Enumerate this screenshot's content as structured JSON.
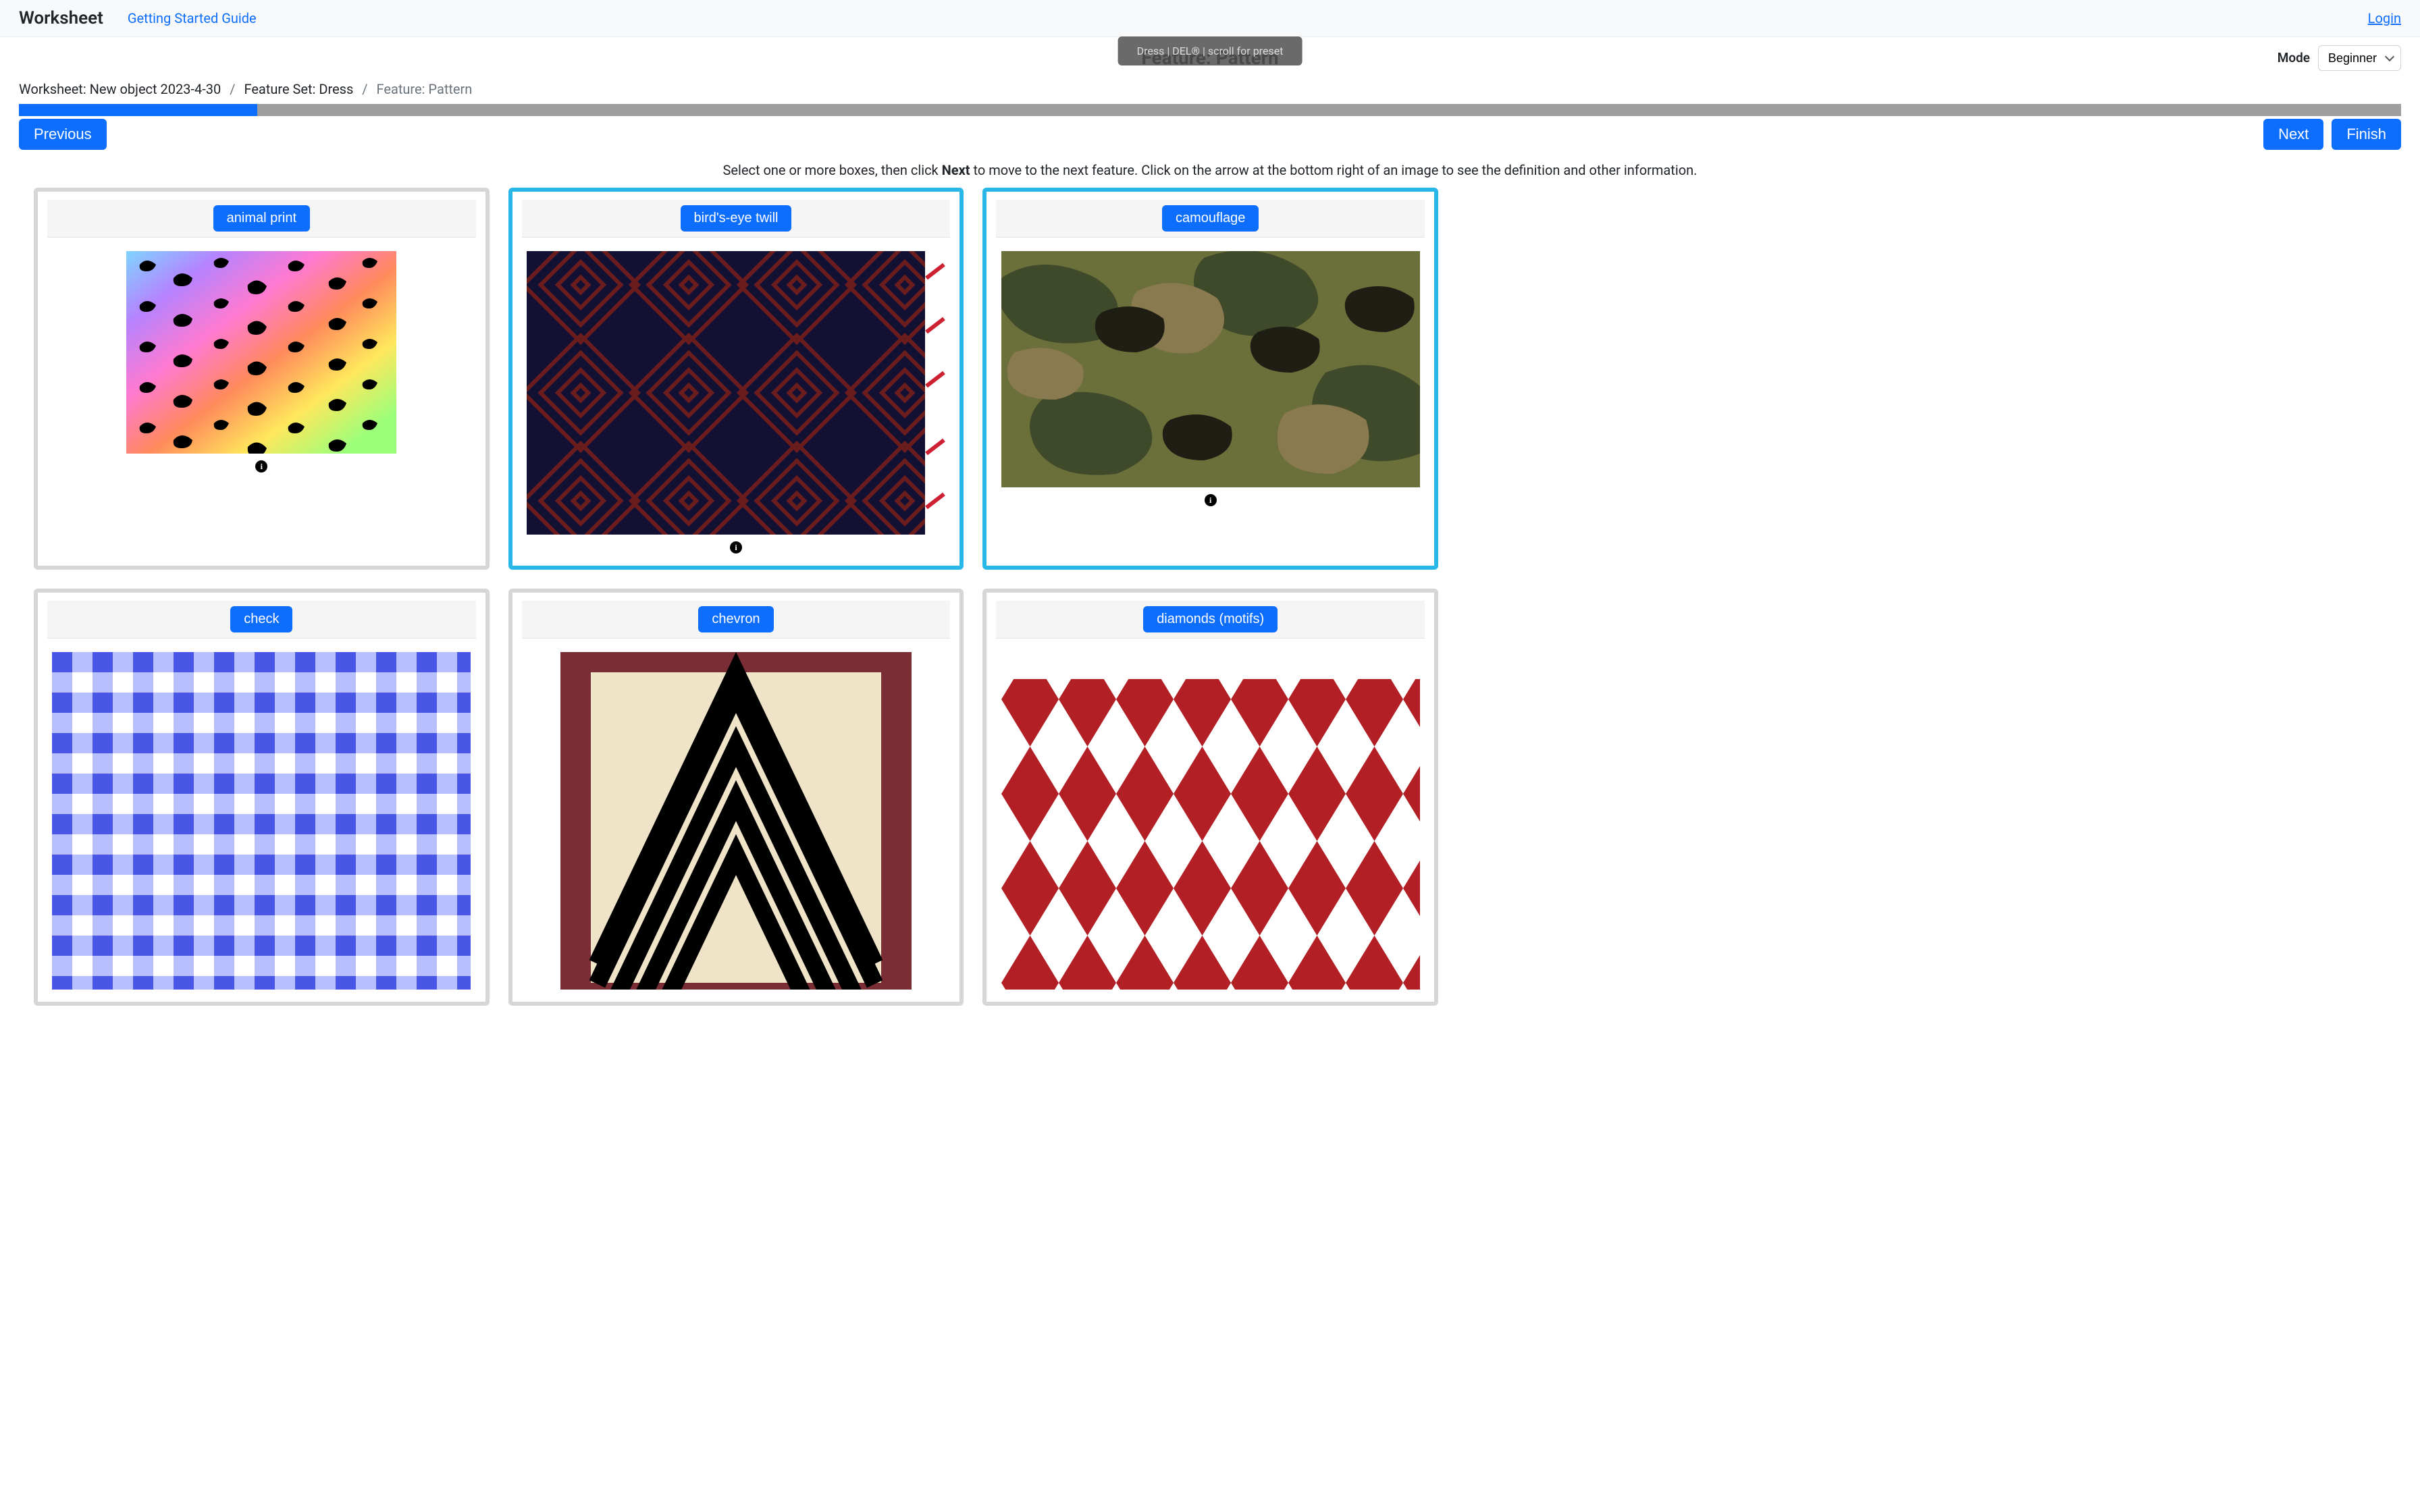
{
  "navbar": {
    "brand": "Worksheet",
    "guide": "Getting Started Guide",
    "login": "Login"
  },
  "toast": "Dress | DEL® | scroll for preset",
  "page_title": "Feature: Pattern",
  "mode": {
    "label": "Mode",
    "selected": "Beginner"
  },
  "breadcrumb": {
    "worksheet": "Worksheet: New object 2023-4-30",
    "featureset": "Feature Set: Dress",
    "current": "Feature: Pattern"
  },
  "progress_percent": 10,
  "buttons": {
    "previous": "Previous",
    "next": "Next",
    "finish": "Finish"
  },
  "instruction_pre": "Select one or more boxes, then click ",
  "instruction_bold": "Next",
  "instruction_post": " to move to the next feature. Click on the arrow at the bottom right of an image to see the definition and other information.",
  "cards": [
    {
      "label": "animal print",
      "selected": false
    },
    {
      "label": "bird's-eye twill",
      "selected": true
    },
    {
      "label": "camouflage",
      "selected": true
    },
    {
      "label": "check",
      "selected": false
    },
    {
      "label": "chevron",
      "selected": false
    },
    {
      "label": "diamonds (motifs)",
      "selected": false
    }
  ],
  "info_glyph": "i"
}
